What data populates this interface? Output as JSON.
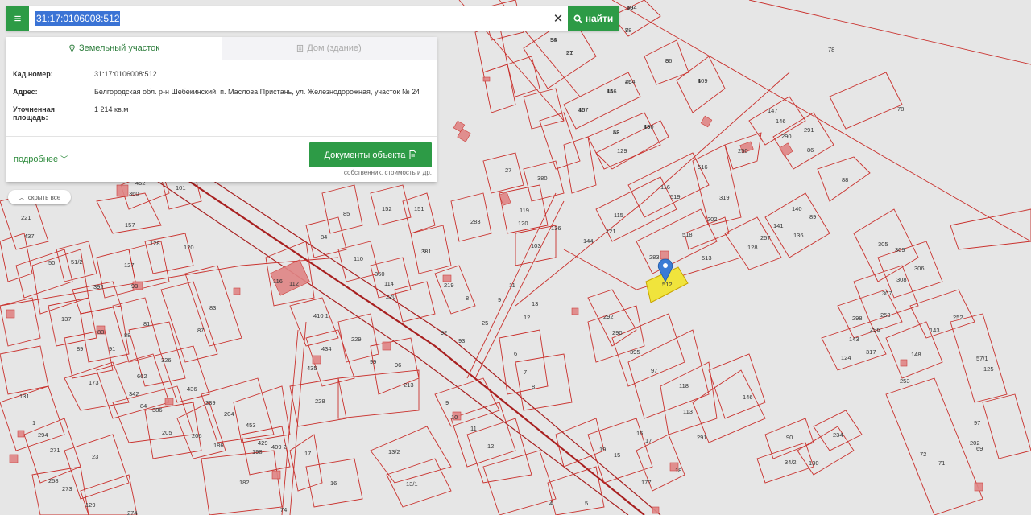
{
  "search": {
    "query": "31:17:0106008:512",
    "find_label": "найти",
    "clear_symbol": "✕"
  },
  "tabs": [
    {
      "label": "Земельный участок",
      "active": true
    },
    {
      "label": "Дом (здание)",
      "active": false
    }
  ],
  "parcel_info": {
    "cad_key": "Кад.номер:",
    "cad_value": "31:17:0106008:512",
    "address_key": "Адрес:",
    "address_value": "Белгородская обл. р-н Шебекинский, п. Маслова Пристань, ул. Железнодорожная, участок № 24",
    "area_key_1": "Уточненная",
    "area_key_2": "площадь:",
    "area_value": "1 214 кв.м"
  },
  "actions": {
    "more_label": "подробнее",
    "docs_label": "Документы объекта",
    "docs_sub": "собственник, стоимость и др.",
    "hide_all_label": "скрыть все"
  },
  "map": {
    "selected_parcel_label": "512",
    "labels": [
      "58",
      "57",
      "404",
      "78",
      "86",
      "109",
      "264",
      "156",
      "157",
      "52",
      "130",
      "129",
      "516",
      "319",
      "88",
      "250",
      "147",
      "146",
      "290",
      "291",
      "86",
      "78",
      "78",
      "452",
      "360",
      "101",
      "221",
      "437",
      "157",
      "120",
      "85",
      "152",
      "151",
      "283",
      "84",
      "110",
      "6",
      "27",
      "380",
      "119",
      "120",
      "136",
      "103",
      "144",
      "121",
      "115",
      "519",
      "116",
      "202",
      "518",
      "283",
      "513",
      "257",
      "141",
      "140",
      "89",
      "136",
      "128",
      "305",
      "309",
      "306",
      "308",
      "307",
      "298",
      "296",
      "253",
      "252",
      "143",
      "143",
      "317",
      "124",
      "148",
      "253",
      "57/1",
      "50",
      "51/2",
      "127",
      "128",
      "392",
      "93",
      "83",
      "87",
      "137",
      "81",
      "83",
      "91",
      "89",
      "88",
      "326",
      "436",
      "173",
      "662",
      "342",
      "84",
      "386",
      "205",
      "206",
      "186",
      "339",
      "204",
      "453",
      "198",
      "429",
      "182",
      "409 2",
      "116",
      "112",
      "410 1",
      "434",
      "435",
      "228",
      "229",
      "99",
      "96",
      "213",
      "360",
      "114",
      "220",
      "219",
      "8",
      "9",
      "11",
      "12",
      "13",
      "93",
      "92",
      "25",
      "381",
      "292",
      "290",
      "395",
      "97",
      "118",
      "113",
      "146",
      "291",
      "6",
      "7",
      "8",
      "9",
      "10",
      "11",
      "12",
      "13/2",
      "13/1",
      "17",
      "16",
      "19",
      "15",
      "16",
      "17",
      "18",
      "177",
      "90",
      "234",
      "34/2",
      "130",
      "131",
      "1",
      "294",
      "271",
      "23",
      "258",
      "273",
      "129",
      "274",
      "4",
      "5",
      "74",
      "125",
      "202",
      "72",
      "71",
      "69",
      "97",
      "94",
      "21",
      "59",
      "8",
      "5",
      "4",
      "45",
      "44",
      "46",
      "48",
      "49"
    ],
    "marker": "location-pin"
  },
  "colors": {
    "accent": "#2d9b46",
    "parcel_stroke": "#c9302c",
    "building_fill": "#e08585",
    "selected_fill": "#f0e43c",
    "marker": "#3a7bd5",
    "selection": "#3a73d5"
  }
}
